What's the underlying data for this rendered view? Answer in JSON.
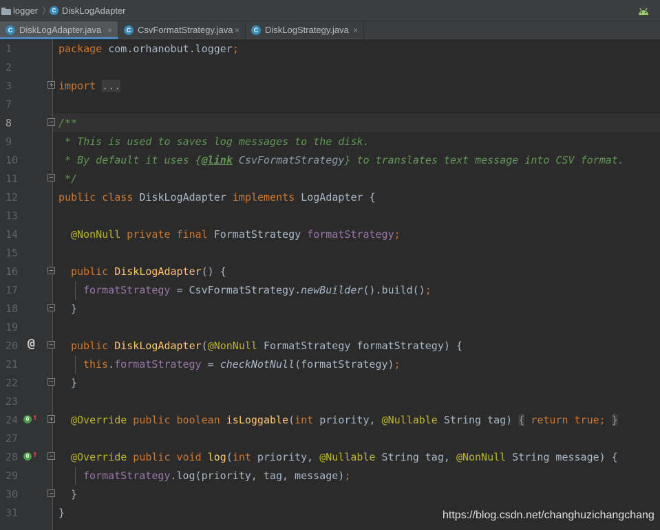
{
  "breadcrumb": {
    "folder": "logger",
    "file": "DiskLogAdapter"
  },
  "tabs": [
    {
      "label": "DiskLogAdapter.java",
      "active": true
    },
    {
      "label": "CsvFormatStrategy.java",
      "active": false
    },
    {
      "label": "DiskLogStrategy.java",
      "active": false
    }
  ],
  "editor": {
    "line_numbers": [
      "1",
      "2",
      "3",
      "7",
      "8",
      "9",
      "10",
      "11",
      "12",
      "13",
      "14",
      "15",
      "16",
      "17",
      "18",
      "19",
      "20",
      "21",
      "22",
      "23",
      "24",
      "27",
      "28",
      "29",
      "30",
      "31"
    ],
    "current_line": "8",
    "code": {
      "package_kw": "package",
      "package_name": " com.orhanobut.logger",
      "semi": ";",
      "import_kw": "import",
      "import_fold": "...",
      "doc_open": "/**",
      "doc_line1": " * This is used to saves log messages to the disk.",
      "doc_line2_a": " * By default it uses {",
      "doc_line2_tag": "@link",
      "doc_line2_ref": " CsvFormatStrategy",
      "doc_line2_b": "} to translates text message into CSV format.",
      "doc_close": " */",
      "class_public": "public",
      "class_class": " class",
      "class_name": " DiskLogAdapter",
      "class_impl": " implements",
      "class_iface": " LogAdapter {",
      "field_ann": "@NonNull",
      "field_mods": " private final",
      "field_type": " FormatStrategy",
      "field_name": " formatStrategy",
      "ctor1_public": "public",
      "ctor1_name": " DiskLogAdapter",
      "ctor1_rest": "() {",
      "ctor1_body_field": "formatStrategy",
      "ctor1_body_eq": " = CsvFormatStrategy.",
      "ctor1_body_method": "newBuilder",
      "ctor1_body_rest": "().build()",
      "close_brace": "}",
      "ctor2_public": "public",
      "ctor2_name": " DiskLogAdapter",
      "ctor2_paren": "(",
      "ctor2_ann": "@NonNull",
      "ctor2_params": " FormatStrategy formatStrategy) {",
      "ctor2_this": "this",
      "ctor2_dot": ".",
      "ctor2_field": "formatStrategy",
      "ctor2_eq": " = ",
      "ctor2_call": "checkNotNull",
      "ctor2_args": "(formatStrategy)",
      "isl_ann": "@Override",
      "isl_mods": " public boolean",
      "isl_name": " isLoggable",
      "isl_paren": "(",
      "isl_int": "int",
      "isl_p1": " priority, ",
      "isl_ann2": "@Nullable",
      "isl_p2": " String tag) ",
      "isl_brace_open": "{",
      "isl_return": " return true",
      "isl_brace_close": "}",
      "log_ann": "@Override",
      "log_mods": " public void",
      "log_name": " log",
      "log_paren": "(",
      "log_int": "int",
      "log_p1": " priority, ",
      "log_ann2": "@Nullable",
      "log_p2": " String tag, ",
      "log_ann3": "@NonNull",
      "log_p3": " String message) {",
      "log_body_field": "formatStrategy",
      "log_body_rest": ".log(priority, tag, message)",
      "class_close": "}"
    },
    "gutter_icons": [
      "at-icon",
      "override-icon",
      "override-icon"
    ]
  },
  "watermark": "https://blog.csdn.net/changhuzichangchang",
  "colors": {
    "background": "#2b2b2b",
    "keyword": "#cc7832",
    "annotation": "#bbb529",
    "field": "#9876aa",
    "method": "#ffc66d",
    "comment": "#629755",
    "text": "#a9b7c6"
  }
}
